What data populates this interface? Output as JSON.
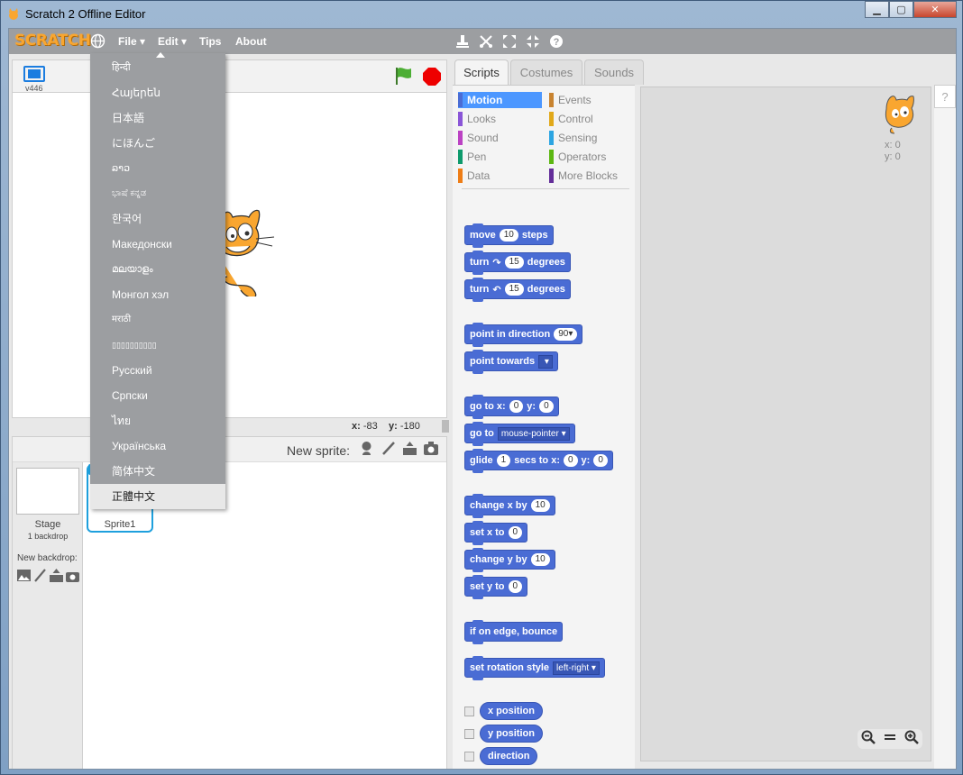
{
  "window": {
    "title": "Scratch 2 Offline Editor"
  },
  "menubar": {
    "logo": "SCRATCH",
    "file": "File",
    "edit": "Edit",
    "tips": "Tips",
    "about": "About"
  },
  "language_menu": {
    "items": [
      "हिन्दी",
      "Հայերեն",
      "日本語",
      "にほんご",
      "ລາວ",
      "ಭಾಷೆ ಕನ್ನಡ",
      "한국어",
      "Македонски",
      "മലയാളം",
      "Монгол хэл",
      "मराठी",
      "▯▯▯▯▯▯▯▯▯▯",
      "Русский",
      "Српски",
      "ไทย",
      "Українська",
      "简体中文",
      "正體中文"
    ],
    "selected": "正體中文"
  },
  "stage": {
    "version": "v446",
    "x_label": "x:",
    "x_value": "-83",
    "y_label": "y:",
    "y_value": "-180"
  },
  "sprites": {
    "new_sprite": "New sprite:",
    "stage_label": "Stage",
    "backdrops": "1 backdrop",
    "new_backdrop": "New backdrop:",
    "sprite_name": "Sprite1",
    "info": "i"
  },
  "tabs": [
    "Scripts",
    "Costumes",
    "Sounds"
  ],
  "categories": [
    {
      "label": "Motion",
      "color": "#4a6cd4"
    },
    {
      "label": "Looks",
      "color": "#8a55d7"
    },
    {
      "label": "Sound",
      "color": "#bb42c3"
    },
    {
      "label": "Pen",
      "color": "#0e9a6c"
    },
    {
      "label": "Data",
      "color": "#ee7d16"
    },
    {
      "label": "Events",
      "color": "#c88330"
    },
    {
      "label": "Control",
      "color": "#e1a91a"
    },
    {
      "label": "Sensing",
      "color": "#2ca5e2"
    },
    {
      "label": "Operators",
      "color": "#5cb712"
    },
    {
      "label": "More Blocks",
      "color": "#632d99"
    }
  ],
  "blocks": {
    "move": "move",
    "steps": "steps",
    "move_val": "10",
    "turn": "turn",
    "degrees": "degrees",
    "turn_val": "15",
    "point_dir": "point in direction",
    "dir_val": "90▾",
    "point_towards": "point towards",
    "goto_xy": "go to x:",
    "y": "y:",
    "zero": "0",
    "goto": "go to",
    "mouse": "mouse-pointer",
    "glide": "glide",
    "secs_to_x": "secs to x:",
    "one": "1",
    "change_x": "change x by",
    "set_x": "set x to",
    "change_y": "change y by",
    "set_y": "set y to",
    "ten": "10",
    "bounce": "if on edge, bounce",
    "rot_style": "set rotation style",
    "rot_val": "left-right",
    "xpos": "x position",
    "ypos": "y position",
    "direction": "direction"
  },
  "scripts_area": {
    "x_label": "x:",
    "x_val": "0",
    "y_label": "y:",
    "y_val": "0"
  },
  "help": "?"
}
